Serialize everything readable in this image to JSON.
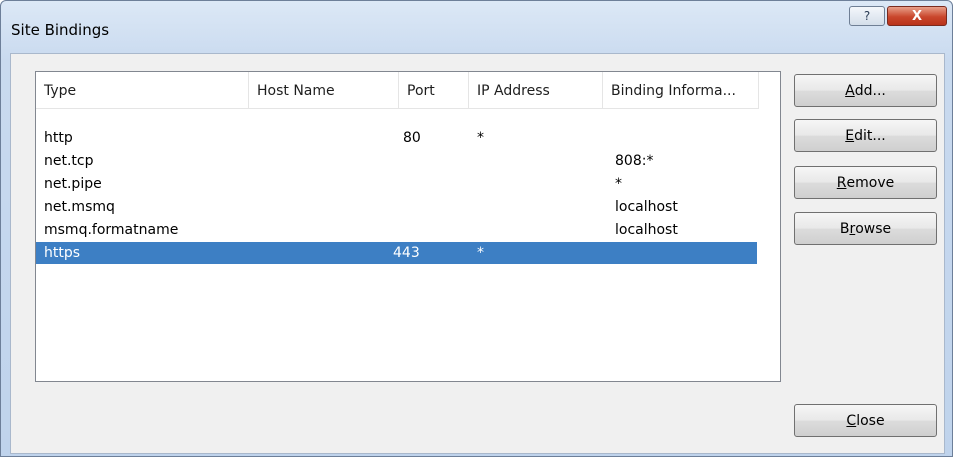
{
  "window": {
    "title": "Site Bindings",
    "help_label": "?",
    "close_label": "X"
  },
  "columns": [
    {
      "label": "Type"
    },
    {
      "label": "Host Name"
    },
    {
      "label": "Port"
    },
    {
      "label": "IP Address"
    },
    {
      "label": "Binding Informa..."
    }
  ],
  "rows": [
    {
      "type": "http",
      "host": "",
      "port": "80",
      "ip": "*",
      "binding": ""
    },
    {
      "type": "net.tcp",
      "host": "",
      "port": "",
      "ip": "",
      "binding": "808:*"
    },
    {
      "type": "net.pipe",
      "host": "",
      "port": "",
      "ip": "",
      "binding": "*"
    },
    {
      "type": "net.msmq",
      "host": "",
      "port": "",
      "ip": "",
      "binding": "localhost"
    },
    {
      "type": "msmq.formatname",
      "host": "",
      "port": "",
      "ip": "",
      "binding": "localhost"
    },
    {
      "type": "https",
      "host": "",
      "port": "443",
      "ip": "*",
      "binding": "",
      "selected": true
    }
  ],
  "buttons": {
    "add": {
      "mnemonic": "A",
      "rest": "dd..."
    },
    "edit": {
      "mnemonic": "E",
      "rest": "dit..."
    },
    "remove": {
      "mnemonic": "R",
      "rest": "emove"
    },
    "browse": {
      "pre": "B",
      "mnemonic": "r",
      "rest": "owse"
    },
    "close": {
      "mnemonic": "C",
      "rest": "lose"
    }
  },
  "colors": {
    "selection": "#3d7fc4",
    "title_close_button": "#c9462c"
  }
}
